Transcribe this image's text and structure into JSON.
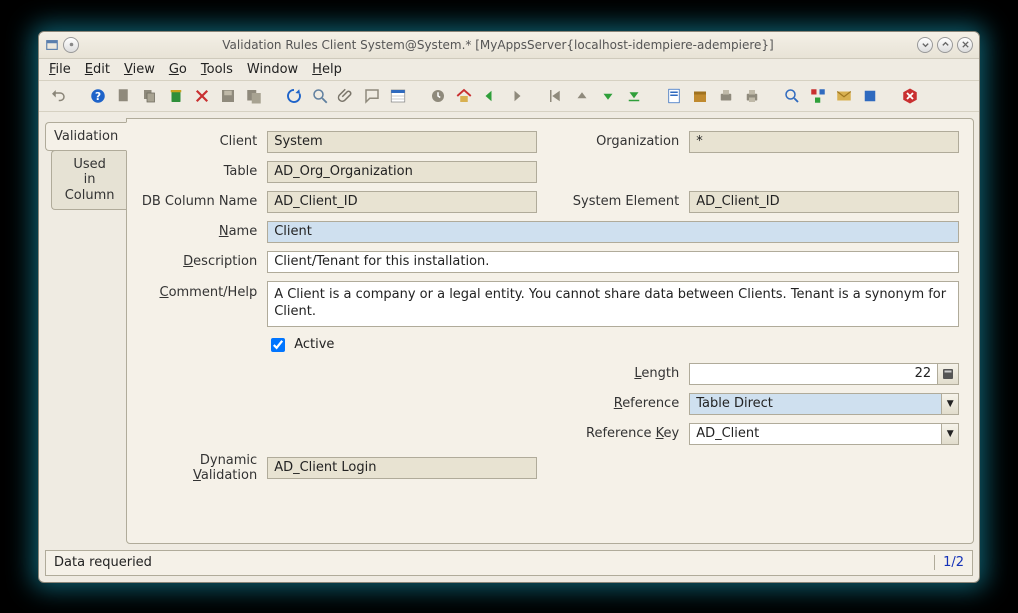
{
  "window": {
    "title": "Validation Rules  Client  System@System.* [MyAppsServer{localhost-idempiere-adempiere}]"
  },
  "menu": {
    "file": "File",
    "edit": "Edit",
    "view": "View",
    "go": "Go",
    "tools": "Tools",
    "window": "Window",
    "help": "Help"
  },
  "tabs": {
    "validation": "Validation",
    "used_in_column_l1": "Used",
    "used_in_column_l2": "in Column"
  },
  "form": {
    "client_label": "Client",
    "client_value": "System",
    "organization_label": "Organization",
    "organization_value": "*",
    "table_label": "Table",
    "table_value": "AD_Org_Organization",
    "dbcol_label": "DB Column Name",
    "dbcol_value": "AD_Client_ID",
    "syselem_label": "System Element",
    "syselem_value": "AD_Client_ID",
    "name_label": "Name",
    "name_value": "Client",
    "description_label": "Description",
    "description_value": "Client/Tenant for this installation.",
    "comment_label": "Comment/Help",
    "comment_value": "A Client is a company or a legal entity. You cannot share data between Clients. Tenant is a synonym for Client.",
    "active_label": "Active",
    "length_label": "Length",
    "length_value": "22",
    "reference_label": "Reference",
    "reference_value": "Table Direct",
    "refkey_label": "Reference Key",
    "refkey_value": "AD_Client",
    "dynval_label": "Dynamic Validation",
    "dynval_value": "AD_Client Login"
  },
  "status": {
    "message": "Data requeried",
    "position": "1/2"
  }
}
